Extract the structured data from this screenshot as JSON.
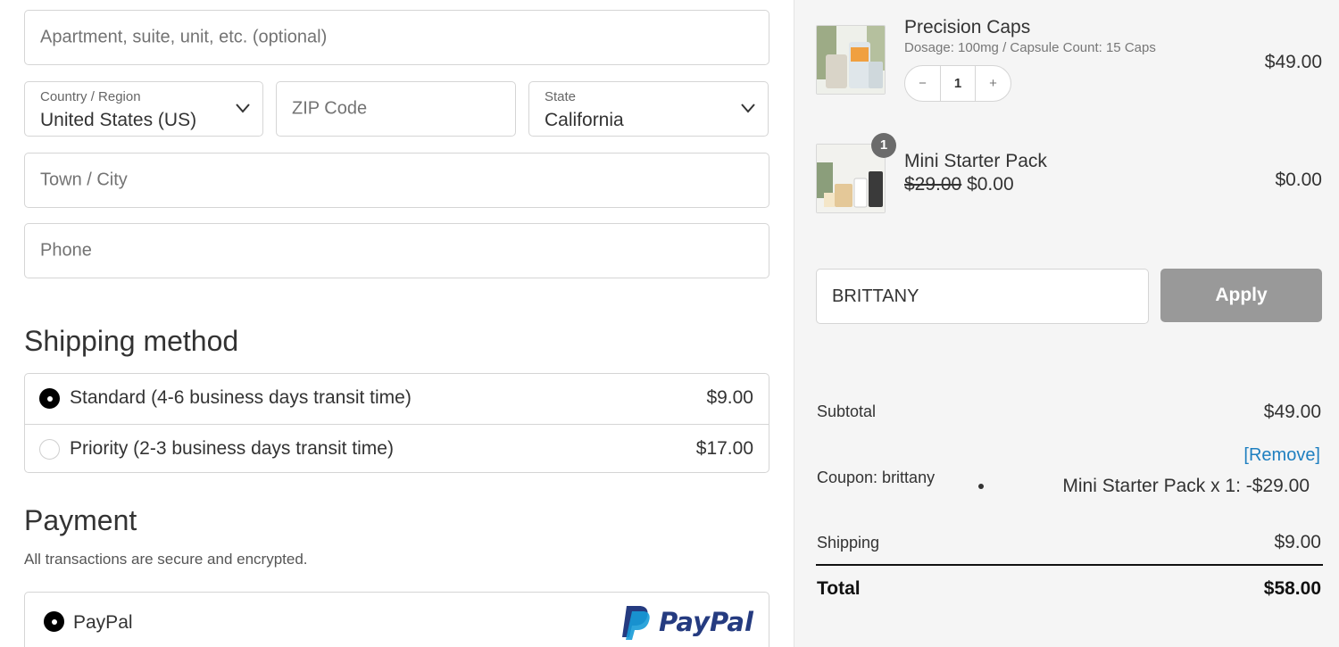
{
  "address": {
    "apartment_placeholder": "Apartment, suite, unit, etc. (optional)",
    "country_label": "Country / Region",
    "country_value": "United States (US)",
    "zip_placeholder": "ZIP Code",
    "state_label": "State",
    "state_value": "California",
    "city_placeholder": "Town / City",
    "phone_placeholder": "Phone"
  },
  "shipping": {
    "title": "Shipping method",
    "options": [
      {
        "label": "Standard (4-6 business days transit time)",
        "price": "$9.00",
        "selected": true
      },
      {
        "label": "Priority (2-3 business days transit time)",
        "price": "$17.00",
        "selected": false
      }
    ]
  },
  "payment": {
    "title": "Payment",
    "subtitle": "All transactions are secure and encrypted.",
    "option_label": "PayPal",
    "logo_text": "PayPal"
  },
  "cart": {
    "items": [
      {
        "name": "Precision Caps",
        "meta": "Dosage: 100mg / Capsule Count: 15 Caps",
        "price": "$49.00",
        "quantity": "1",
        "minus": "−",
        "plus": "+"
      },
      {
        "name": "Mini Starter Pack",
        "original_price": "$29.00",
        "sale_price": "$0.00",
        "price": "$0.00",
        "badge": "1"
      }
    ]
  },
  "coupon": {
    "input_value": "BRITTANY",
    "apply_label": "Apply"
  },
  "summary": {
    "subtotal_label": "Subtotal",
    "subtotal_value": "$49.00",
    "coupon_label": "Coupon: brittany",
    "remove_label": "[Remove]",
    "discount_line": "Mini Starter Pack x 1: -$29.00",
    "shipping_label": "Shipping",
    "shipping_value": "$9.00",
    "total_label": "Total",
    "total_value": "$58.00"
  },
  "colors": {
    "link": "#1e7fc0",
    "apply_button": "#999999",
    "paypal_dark": "#253b80",
    "paypal_light": "#179bd7"
  }
}
